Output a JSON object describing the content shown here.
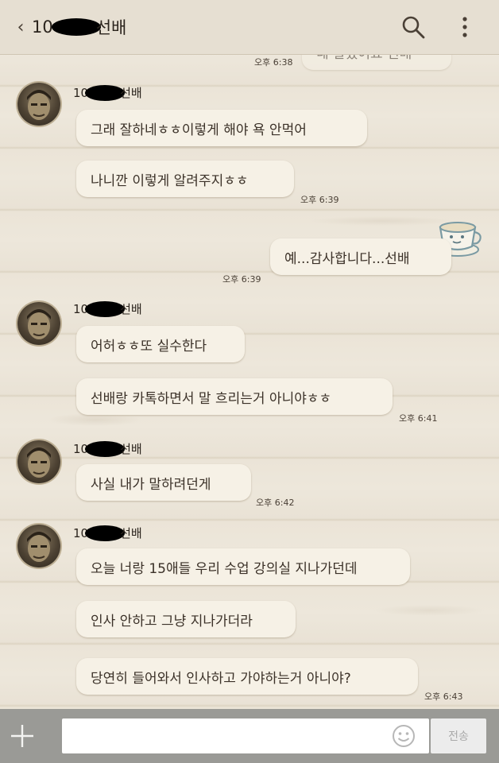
{
  "header": {
    "back_glyph": "‹",
    "title_prefix": "10",
    "title_suffix": "선배"
  },
  "messages": {
    "partial_top_text": "네 알겠어요 선배",
    "partial_top_time": "오후 6:38",
    "group1": {
      "sender_prefix": "10",
      "sender_suffix": "선배",
      "m1": "그래 잘하네ㅎㅎ이렇게 해야 욕 안먹어",
      "m2": "나니깐 이렇게 알려주지ㅎㅎ",
      "time": "오후 6:39"
    },
    "mine": {
      "m1": "예...감사합니다...선배",
      "time": "오후 6:39"
    },
    "group2": {
      "sender_prefix": "10",
      "sender_suffix": "선배",
      "m1": "어허ㅎㅎ또 실수한다",
      "m2": "선배랑 카톡하면서 말 흐리는거 아니야ㅎㅎ",
      "time": "오후 6:41"
    },
    "group3": {
      "sender_prefix": "10",
      "sender_suffix": "선배",
      "m1": "사실 내가 말하려던게",
      "time": "오후 6:42"
    },
    "group4": {
      "sender_prefix": "10",
      "sender_suffix": "선배",
      "m1": "오늘 너랑 15애들 우리 수업 강의실 지나가던데",
      "m2": "인사 안하고 그냥 지나가더라",
      "m3": "당연히 들어와서 인사하고 가야하는거 아니야?",
      "time": "오후 6:43"
    }
  },
  "input": {
    "plus_glyph": "+",
    "send_label": "전송"
  },
  "colors": {
    "bubble": "#f6f1e6",
    "input_bar": "#9a9a96",
    "header": "#e6dfd2"
  }
}
